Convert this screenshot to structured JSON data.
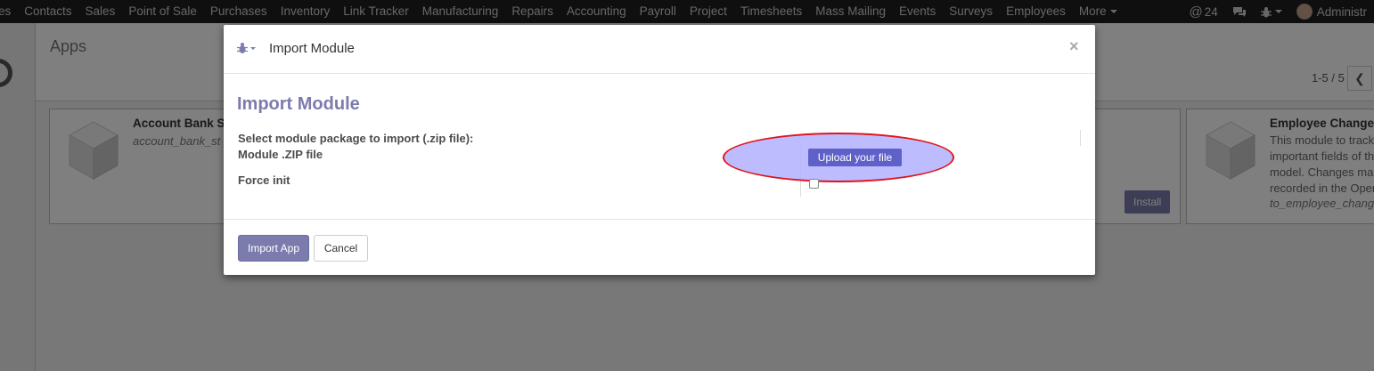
{
  "topnav": {
    "menu_items": [
      "es",
      "Contacts",
      "Sales",
      "Point of Sale",
      "Purchases",
      "Inventory",
      "Link Tracker",
      "Manufacturing",
      "Repairs",
      "Accounting",
      "Payroll",
      "Project",
      "Timesheets",
      "Mass Mailing",
      "Events",
      "Surveys",
      "Employees",
      "More"
    ],
    "mentions_count": "24",
    "user_name": "Administr"
  },
  "apps_page": {
    "title": "Apps",
    "pager": "1-5 / 5",
    "cards": [
      {
        "title": "Account Bank St",
        "technical": "account_bank_st"
      },
      {
        "title": "Employee Changes",
        "desc": [
          "This module to track",
          "important fields of th",
          "model. Changes mac",
          "recorded in the Oper"
        ],
        "technical": "to_employee_chang"
      }
    ],
    "install_label": "Install"
  },
  "modal": {
    "header_title": "Import Module",
    "form_title": "Import Module",
    "label_select": "Select module package to import (.zip file):",
    "label_zip": "Module .ZIP file",
    "label_force": "Force init",
    "upload_label": "Upload your file",
    "import_label": "Import App",
    "cancel_label": "Cancel",
    "close_symbol": "×"
  },
  "colors": {
    "topbar": "#1e1e1e",
    "primary": "#7c7bad",
    "upload": "#6061c8",
    "highlight_border": "#e0141d",
    "highlight_fill": "#b0b0ff"
  },
  "icons": [
    "bug-icon",
    "at-icon",
    "chat-icon",
    "chevron-left-icon",
    "close-icon",
    "module-cube-icon",
    "avatar"
  ]
}
